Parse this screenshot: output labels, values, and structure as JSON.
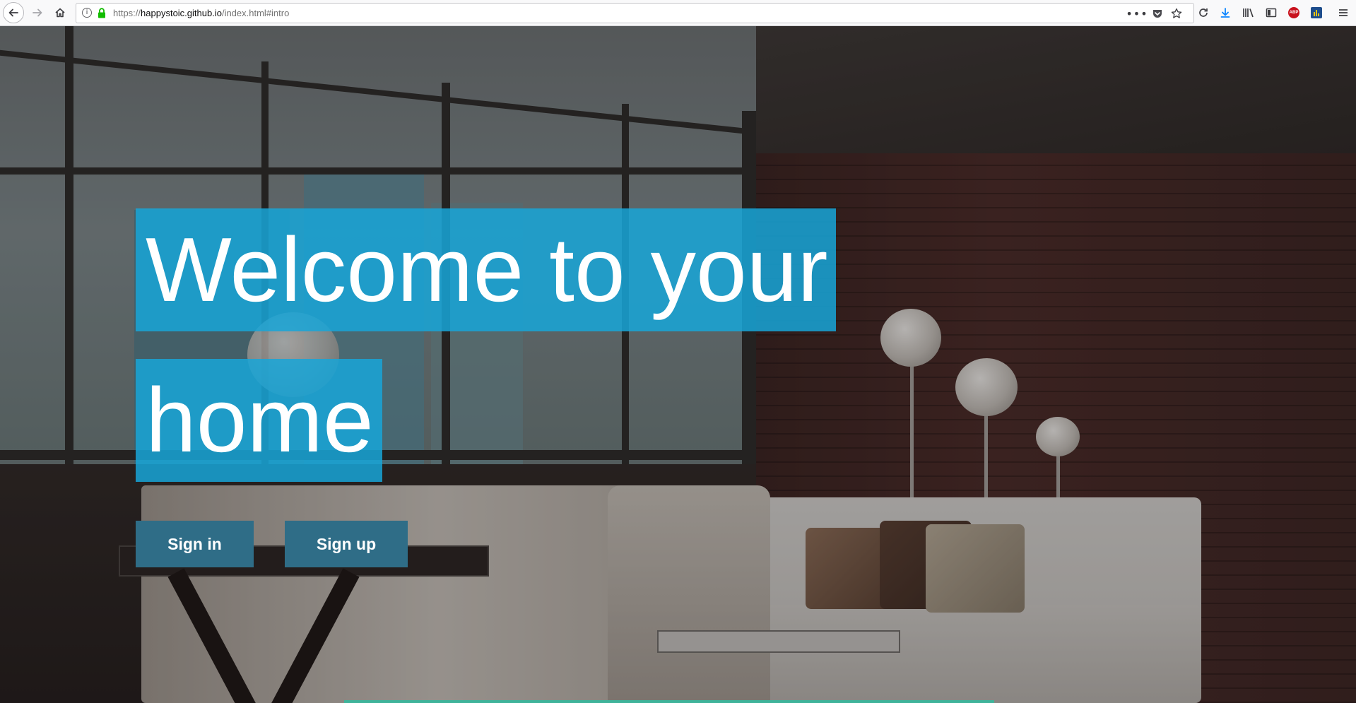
{
  "browser": {
    "url_scheme": "https://",
    "url_host": "happystoic.github.io",
    "url_path": "/index.html#intro",
    "icons": {
      "back": "back-arrow-icon",
      "forward": "forward-arrow-icon",
      "home": "home-icon",
      "info": "info-icon",
      "lock": "lock-icon",
      "page_actions": "more-actions-icon",
      "pocket": "pocket-icon",
      "bookmark": "bookmark-star-icon",
      "reload": "reload-icon",
      "downloads": "download-icon",
      "library": "library-icon",
      "sidebar": "sidebar-icon",
      "adblock": "adblock-plus-icon",
      "extension": "extension-icon",
      "menu": "hamburger-menu-icon"
    },
    "adblock_label": "ABP"
  },
  "hero": {
    "headline_line1": "Welcome to your",
    "headline_line2": "home",
    "sign_in_label": "Sign in",
    "sign_up_label": "Sign up"
  },
  "colors": {
    "headline_highlight": "#17a6d8",
    "button_bg": "#2f6d87",
    "accent_bar": "#3fb39a",
    "lock_green": "#12bc00"
  }
}
